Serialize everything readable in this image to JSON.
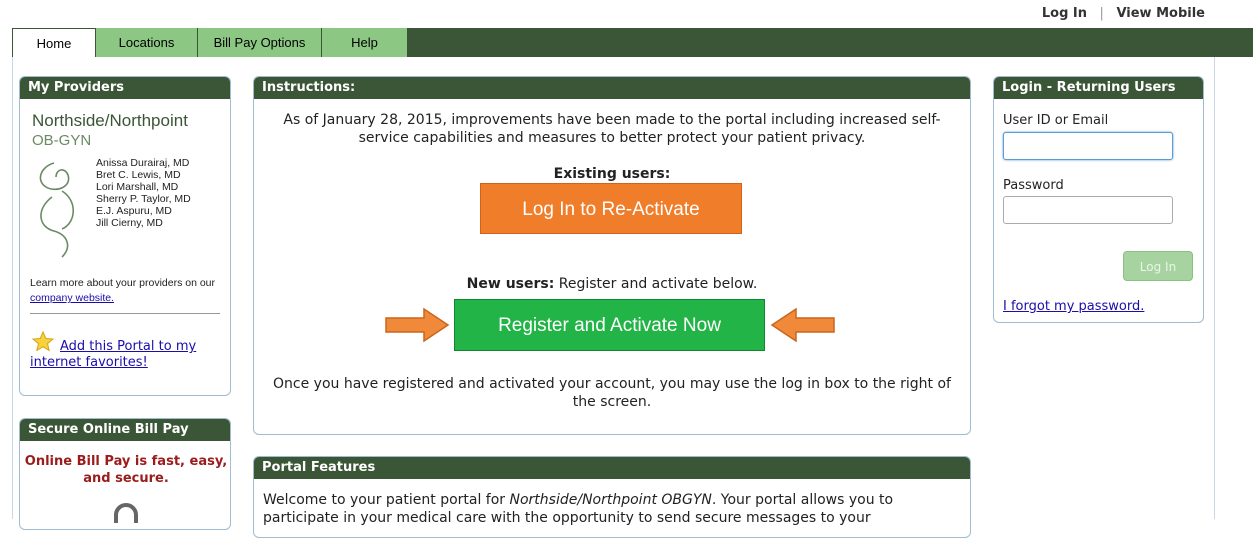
{
  "top_links": {
    "login": "Log In",
    "separator": "|",
    "view_mobile": "View Mobile"
  },
  "nav": {
    "tabs": [
      "Home",
      "Locations",
      "Bill Pay Options",
      "Help"
    ]
  },
  "providers": {
    "title": "My Providers",
    "brand_line1": "Northside/Northpoint",
    "brand_line2": "OB-GYN",
    "doctors": [
      "Anissa Durairaj, MD",
      "Bret C. Lewis, MD",
      "Lori Marshall, MD",
      "Sherry P. Taylor, MD",
      "E.J. Aspuru, MD",
      "Jill Cierny, MD"
    ],
    "learn_text": "Learn more about your providers on our",
    "learn_link": "company website.",
    "favorites_link": "Add this Portal to my internet favorites!"
  },
  "billpay": {
    "title": "Secure Online Bill Pay",
    "tagline": "Online Bill Pay is fast, easy, and secure."
  },
  "instructions": {
    "title": "Instructions:",
    "intro": "As of January 28, 2015, improvements have been made to the portal including increased self-service capabilities and measures to better protect your patient privacy.",
    "existing_label": "Existing users:",
    "reactivate_button": "Log In to Re-Activate",
    "new_label_bold": "New users:",
    "new_label_rest": " Register and activate below.",
    "register_button": "Register and Activate Now",
    "footer_text": "Once you have registered and activated your account, you may use the log in box to the right of the screen."
  },
  "features": {
    "title": "Portal Features",
    "text_start": "Welcome to your patient portal for ",
    "text_italic": "Northside/Northpoint OBGYN",
    "text_end": ". Your portal allows you to participate in your medical care with the opportunity to send secure messages to your"
  },
  "login": {
    "title": "Login - Returning Users",
    "user_label": "User ID or Email",
    "user_value": "",
    "password_label": "Password",
    "password_value": "",
    "login_button": "Log In",
    "forgot_link": "I forgot my password."
  },
  "colors": {
    "nav_dark": "#3b5636",
    "tab_green": "#8cc884",
    "orange_button": "#f07d2a",
    "green_button": "#22b447",
    "bill_red": "#9b1c1c"
  }
}
